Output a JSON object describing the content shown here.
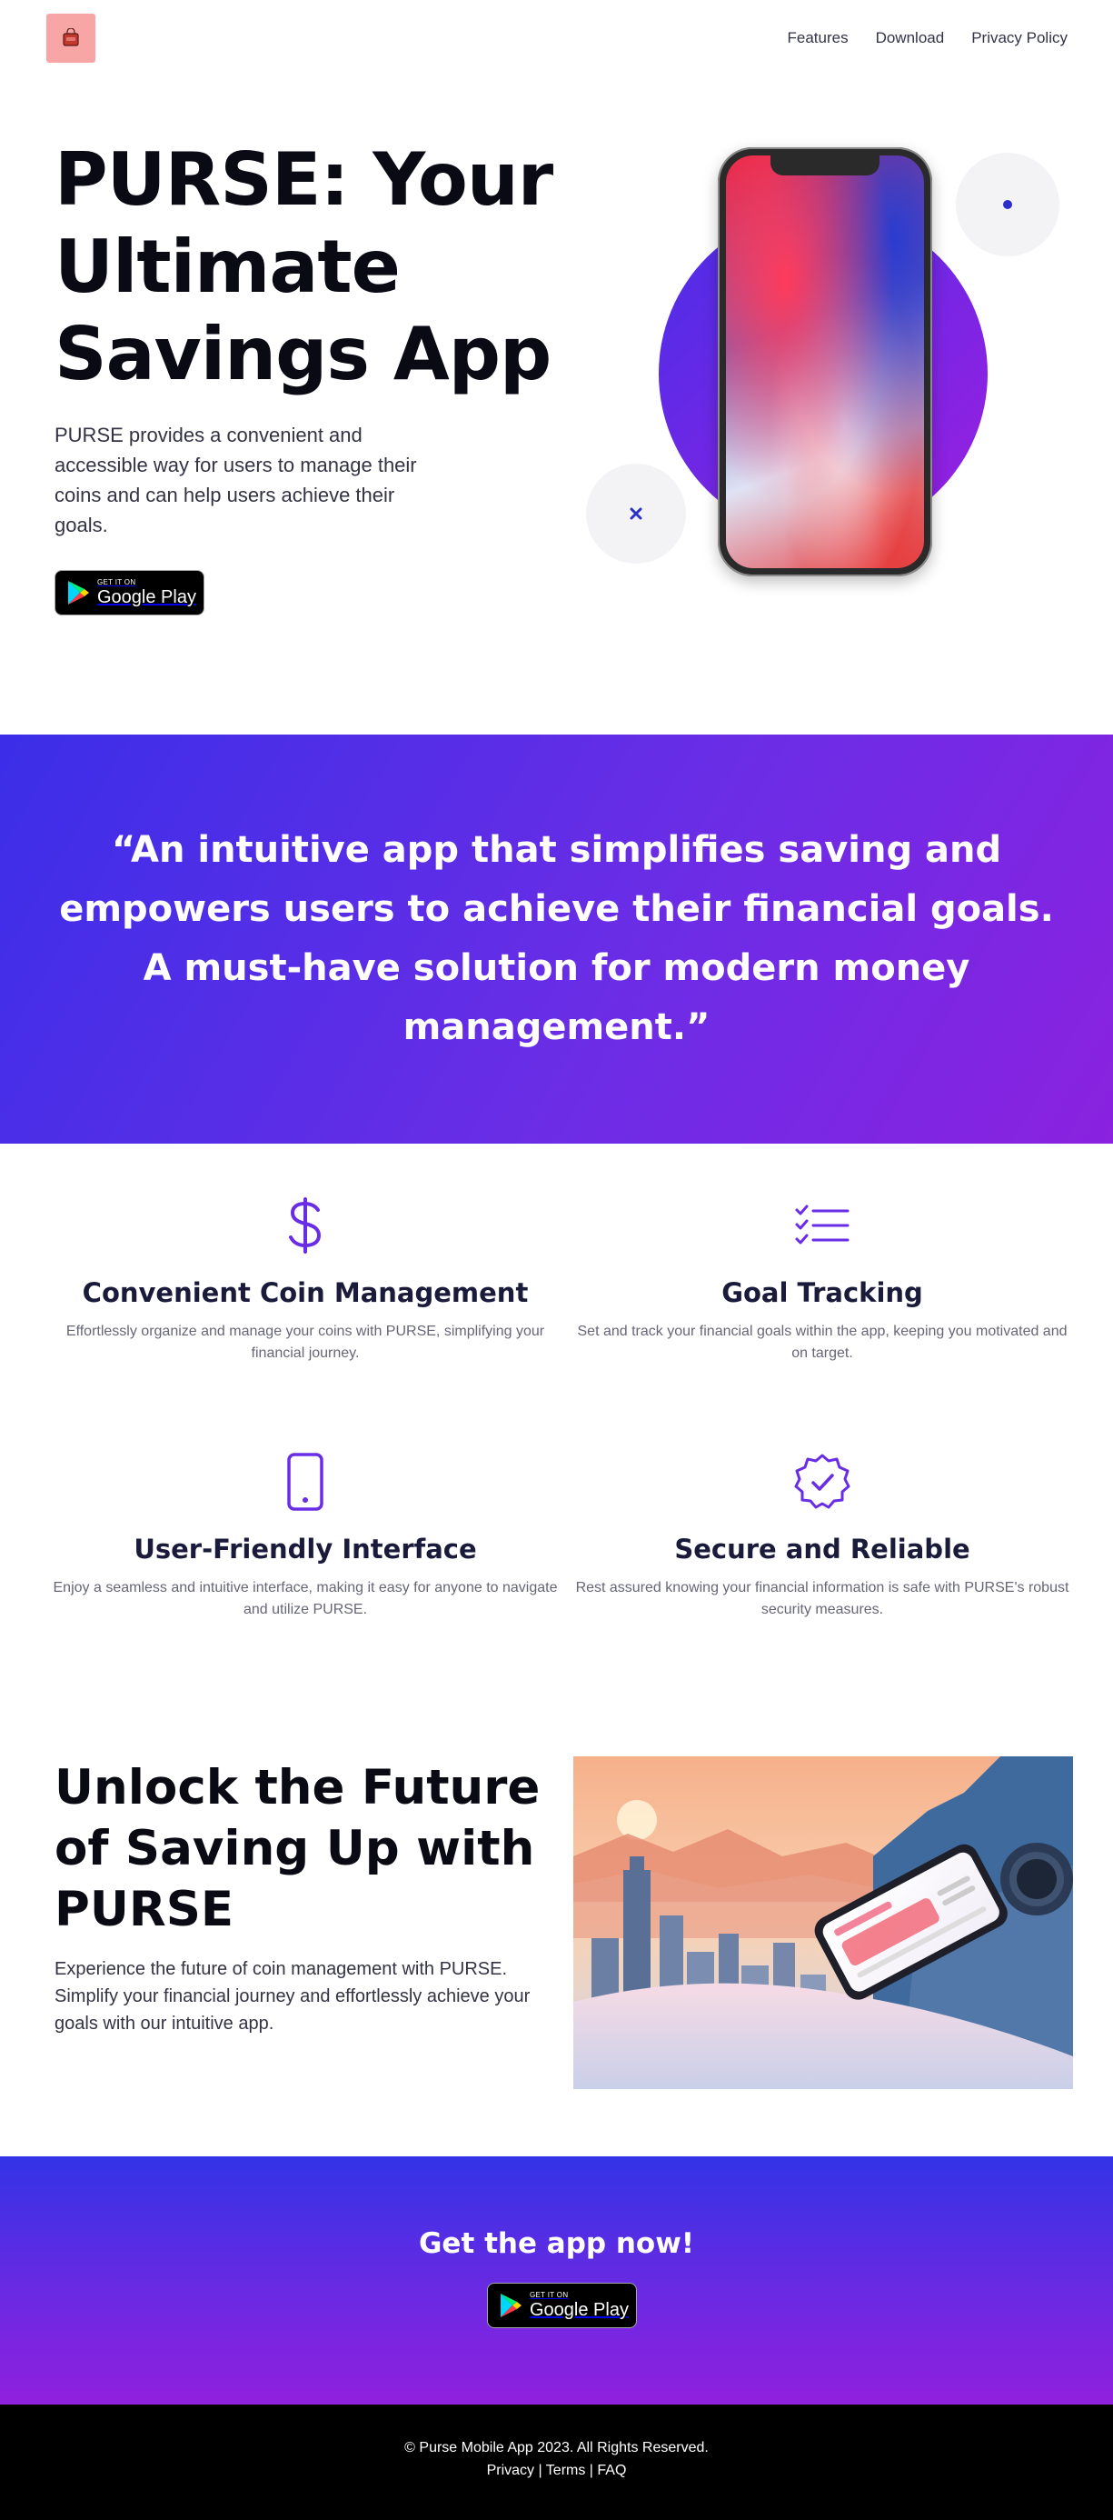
{
  "nav": {
    "links": [
      "Features",
      "Download",
      "Privacy Policy"
    ]
  },
  "hero": {
    "title": "PURSE: Your Ultimate Savings App",
    "description": "PURSE provides a convenient and accessible way for users to manage their coins and can help users achieve their goals.",
    "badge_small": "GET IT ON",
    "badge_big": "Google Play"
  },
  "testimonial": {
    "quote": "“An intuitive app that simplifies saving and empowers users to achieve their financial goals. A must-have solution for modern money management.”"
  },
  "features": [
    {
      "icon": "dollar-icon",
      "title": "Convenient Coin Management",
      "description": "Effortlessly organize and manage your coins with PURSE, simplifying your financial journey."
    },
    {
      "icon": "checklist-icon",
      "title": "Goal Tracking",
      "description": "Set and track your financial goals within the app, keeping you motivated and on target."
    },
    {
      "icon": "phone-icon",
      "title": "User-Friendly Interface",
      "description": "Enjoy a seamless and intuitive interface, making it easy for anyone to navigate and utilize PURSE."
    },
    {
      "icon": "verified-badge-icon",
      "title": "Secure and Reliable",
      "description": "Rest assured knowing your financial information is safe with PURSE's robust security measures."
    }
  ],
  "unlock": {
    "title": "Unlock the Future of Saving Up with PURSE",
    "description": "Experience the future of coin management with PURSE. Simplify your financial journey and effortlessly achieve your goals with our intuitive app."
  },
  "cta": {
    "title": "Get the app now!",
    "badge_small": "GET IT ON",
    "badge_big": "Google Play"
  },
  "footer": {
    "copyright": "© Purse Mobile App 2023. All Rights Reserved.",
    "links": [
      "Privacy",
      "Terms",
      "FAQ"
    ],
    "separator": " | "
  },
  "colors": {
    "accent_purple": "#6a2de6",
    "accent_blue": "#3b2ee8",
    "logo_bg": "#f7a5a5"
  }
}
